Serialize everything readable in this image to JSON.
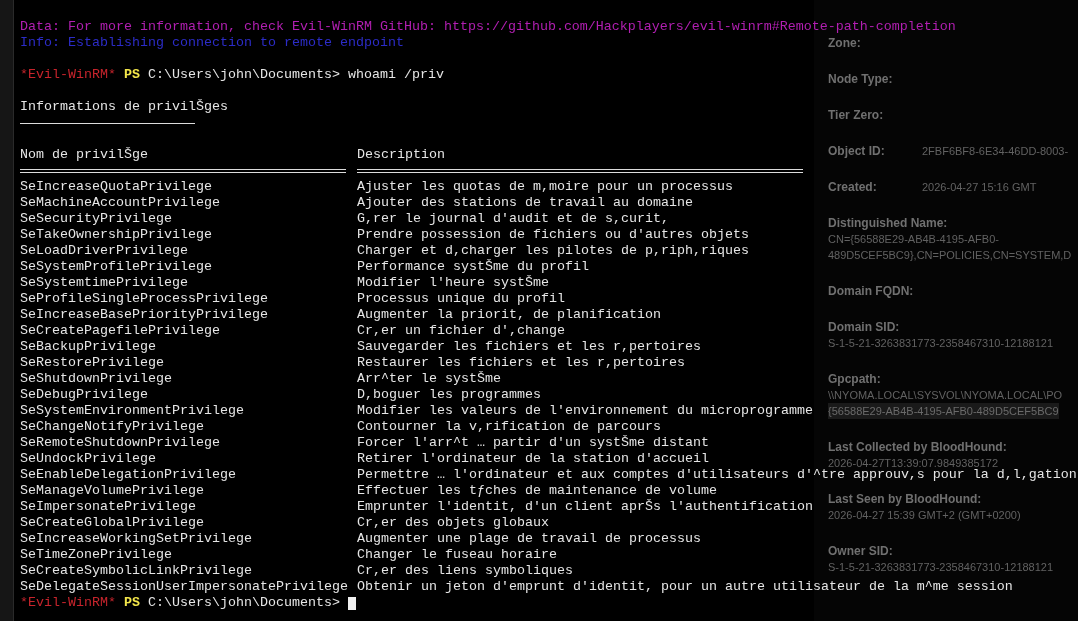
{
  "banner": [
    {
      "kind": "data",
      "text": "Data: For more information, check Evil-WinRM GitHub: https://github.com/Hackplayers/evil-winrm#Remote-path-completion"
    },
    {
      "kind": "info",
      "text": "Info: Establishing connection to remote endpoint"
    }
  ],
  "prompt": {
    "marker": "*Evil-WinRM*",
    "shell": "PS",
    "path": "C:\\Users\\john\\Documents>",
    "command": "whoami /priv"
  },
  "section_title": "Informations de privilŠges",
  "table": {
    "columns": [
      "Nom de privilŠge",
      "Description"
    ],
    "rows": [
      {
        "name": "SeIncreaseQuotaPrivilege",
        "description": "Ajuster les quotas de m,moire pour un processus"
      },
      {
        "name": "SeMachineAccountPrivilege",
        "description": "Ajouter des stations de travail au domaine"
      },
      {
        "name": "SeSecurityPrivilege",
        "description": "G,rer le journal d'audit et de s,curit,"
      },
      {
        "name": "SeTakeOwnershipPrivilege",
        "description": "Prendre possession de fichiers ou d'autres objets"
      },
      {
        "name": "SeLoadDriverPrivilege",
        "description": "Charger et d,charger les pilotes de p,riph,riques"
      },
      {
        "name": "SeSystemProfilePrivilege",
        "description": "Performance systŠme du profil"
      },
      {
        "name": "SeSystemtimePrivilege",
        "description": "Modifier l'heure systŠme"
      },
      {
        "name": "SeProfileSingleProcessPrivilege",
        "description": "Processus unique du profil"
      },
      {
        "name": "SeIncreaseBasePriorityPrivilege",
        "description": "Augmenter la priorit, de planification"
      },
      {
        "name": "SeCreatePagefilePrivilege",
        "description": "Cr,er un fichier d',change"
      },
      {
        "name": "SeBackupPrivilege",
        "description": "Sauvegarder les fichiers et les r,pertoires"
      },
      {
        "name": "SeRestorePrivilege",
        "description": "Restaurer les fichiers et les r,pertoires"
      },
      {
        "name": "SeShutdownPrivilege",
        "description": "Arr^ter le systŠme"
      },
      {
        "name": "SeDebugPrivilege",
        "description": "D,boguer les programmes"
      },
      {
        "name": "SeSystemEnvironmentPrivilege",
        "description": "Modifier les valeurs de l'environnement du microprogramme"
      },
      {
        "name": "SeChangeNotifyPrivilege",
        "description": "Contourner la v,rification de parcours"
      },
      {
        "name": "SeRemoteShutdownPrivilege",
        "description": "Forcer l'arr^t … partir d'un systŠme distant"
      },
      {
        "name": "SeUndockPrivilege",
        "description": "Retirer l'ordinateur de la station d'accueil"
      },
      {
        "name": "SeEnableDelegationPrivilege",
        "description": "Permettre … l'ordinateur et aux comptes d'utilisateurs d'^tre approuv,s pour la d,l,gation"
      },
      {
        "name": "SeManageVolumePrivilege",
        "description": "Effectuer les tƒches de maintenance de volume"
      },
      {
        "name": "SeImpersonatePrivilege",
        "description": "Emprunter l'identit, d'un client aprŠs l'authentification"
      },
      {
        "name": "SeCreateGlobalPrivilege",
        "description": "Cr,er des objets globaux"
      },
      {
        "name": "SeIncreaseWorkingSetPrivilege",
        "description": "Augmenter une plage de travail de processus"
      },
      {
        "name": "SeTimeZonePrivilege",
        "description": "Changer le fuseau horaire"
      },
      {
        "name": "SeCreateSymbolicLinkPrivilege",
        "description": "Cr,er des liens symboliques"
      },
      {
        "name": "SeDelegateSessionUserImpersonatePrivilege",
        "description": "Obtenir un jeton d'emprunt d'identit, pour un autre utilisateur de la m^me session"
      }
    ]
  },
  "final_prompt": {
    "marker": "*Evil-WinRM*",
    "shell": "PS",
    "path": "C:\\Users\\john\\Documents>",
    "cursor": true
  },
  "background_panel": {
    "fields": [
      {
        "label": "Zone:"
      },
      {
        "label": "Node Type:"
      },
      {
        "label": "Tier Zero:"
      },
      {
        "label": "Object ID:",
        "inline_value": "2FBF6BF8-6E34-46DD-8003-"
      },
      {
        "label": "Created:",
        "inline_value": "2026-04-27 15:16 GMT"
      },
      {
        "label": "Distinguished Name:",
        "values": [
          "CN={56588E29-AB4B-4195-AFB0-",
          "489D5CEF5BC9},CN=POLICIES,CN=SYSTEM,D"
        ]
      },
      {
        "label": "Domain FQDN:"
      },
      {
        "label": "Domain SID:",
        "values": [
          "S-1-5-21-3263831773-2358467310-12188121"
        ]
      },
      {
        "label": "Gpcpath:",
        "values": [
          "\\\\NYOMA.LOCAL\\SYSVOL\\NYOMA.LOCAL\\PO"
        ],
        "highlighted_value": "{56588E29-AB4B-4195-AFB0-489D5CEF5BC9"
      },
      {
        "label": "Last Collected by BloodHound:",
        "values": [
          "2026-04-27T13:39:07.9849385172"
        ]
      },
      {
        "label": "Last Seen by BloodHound:",
        "values": [
          "2026-04-27 15:39 GMT+2 (GMT+0200)"
        ]
      },
      {
        "label": "Owner SID:",
        "values": [
          "S-1-5-21-3263831773-2358467310-12188121"
        ]
      }
    ]
  }
}
